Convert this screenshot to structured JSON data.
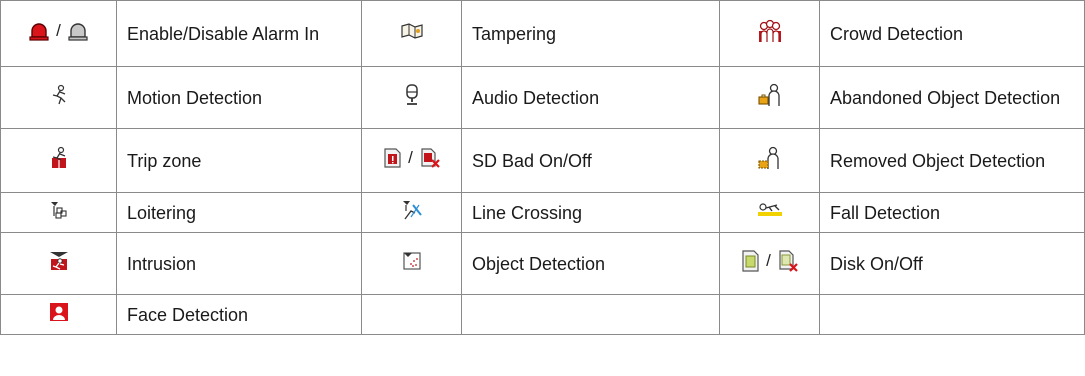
{
  "rows": [
    {
      "cells": [
        {
          "icons": [
            "alarm-in-on-icon",
            "alarm-in-off-icon"
          ],
          "separator": "/",
          "label": "Enable/Disable Alarm In"
        },
        {
          "icons": [
            "tampering-icon"
          ],
          "label": "Tampering"
        },
        {
          "icons": [
            "crowd-detection-icon"
          ],
          "label": "Crowd Detection"
        }
      ]
    },
    {
      "cells": [
        {
          "icons": [
            "motion-detection-icon"
          ],
          "label": "Motion Detection"
        },
        {
          "icons": [
            "audio-detection-icon"
          ],
          "label": "Audio Detection"
        },
        {
          "icons": [
            "abandoned-object-icon"
          ],
          "label": "Abandoned Object Detection"
        }
      ]
    },
    {
      "cells": [
        {
          "icons": [
            "trip-zone-icon"
          ],
          "label": "Trip zone"
        },
        {
          "icons": [
            "sd-bad-on-icon",
            "sd-bad-off-icon"
          ],
          "separator": "/",
          "label": "SD Bad On/Off"
        },
        {
          "icons": [
            "removed-object-icon"
          ],
          "label": "Removed Object Detection"
        }
      ]
    },
    {
      "cells": [
        {
          "icons": [
            "loitering-icon"
          ],
          "label": "Loitering"
        },
        {
          "icons": [
            "line-crossing-icon"
          ],
          "label": "Line Crossing"
        },
        {
          "icons": [
            "fall-detection-icon"
          ],
          "label": "Fall Detection"
        }
      ]
    },
    {
      "cells": [
        {
          "icons": [
            "intrusion-icon"
          ],
          "label": "Intrusion"
        },
        {
          "icons": [
            "object-detection-icon"
          ],
          "label": "Object Detection"
        },
        {
          "icons": [
            "disk-on-icon",
            "disk-off-icon"
          ],
          "separator": "/",
          "label": "Disk On/Off"
        }
      ]
    },
    {
      "cells": [
        {
          "icons": [
            "face-detection-icon"
          ],
          "label": "Face Detection"
        },
        {
          "icons": [],
          "label": ""
        },
        {
          "icons": [],
          "label": ""
        }
      ]
    }
  ]
}
